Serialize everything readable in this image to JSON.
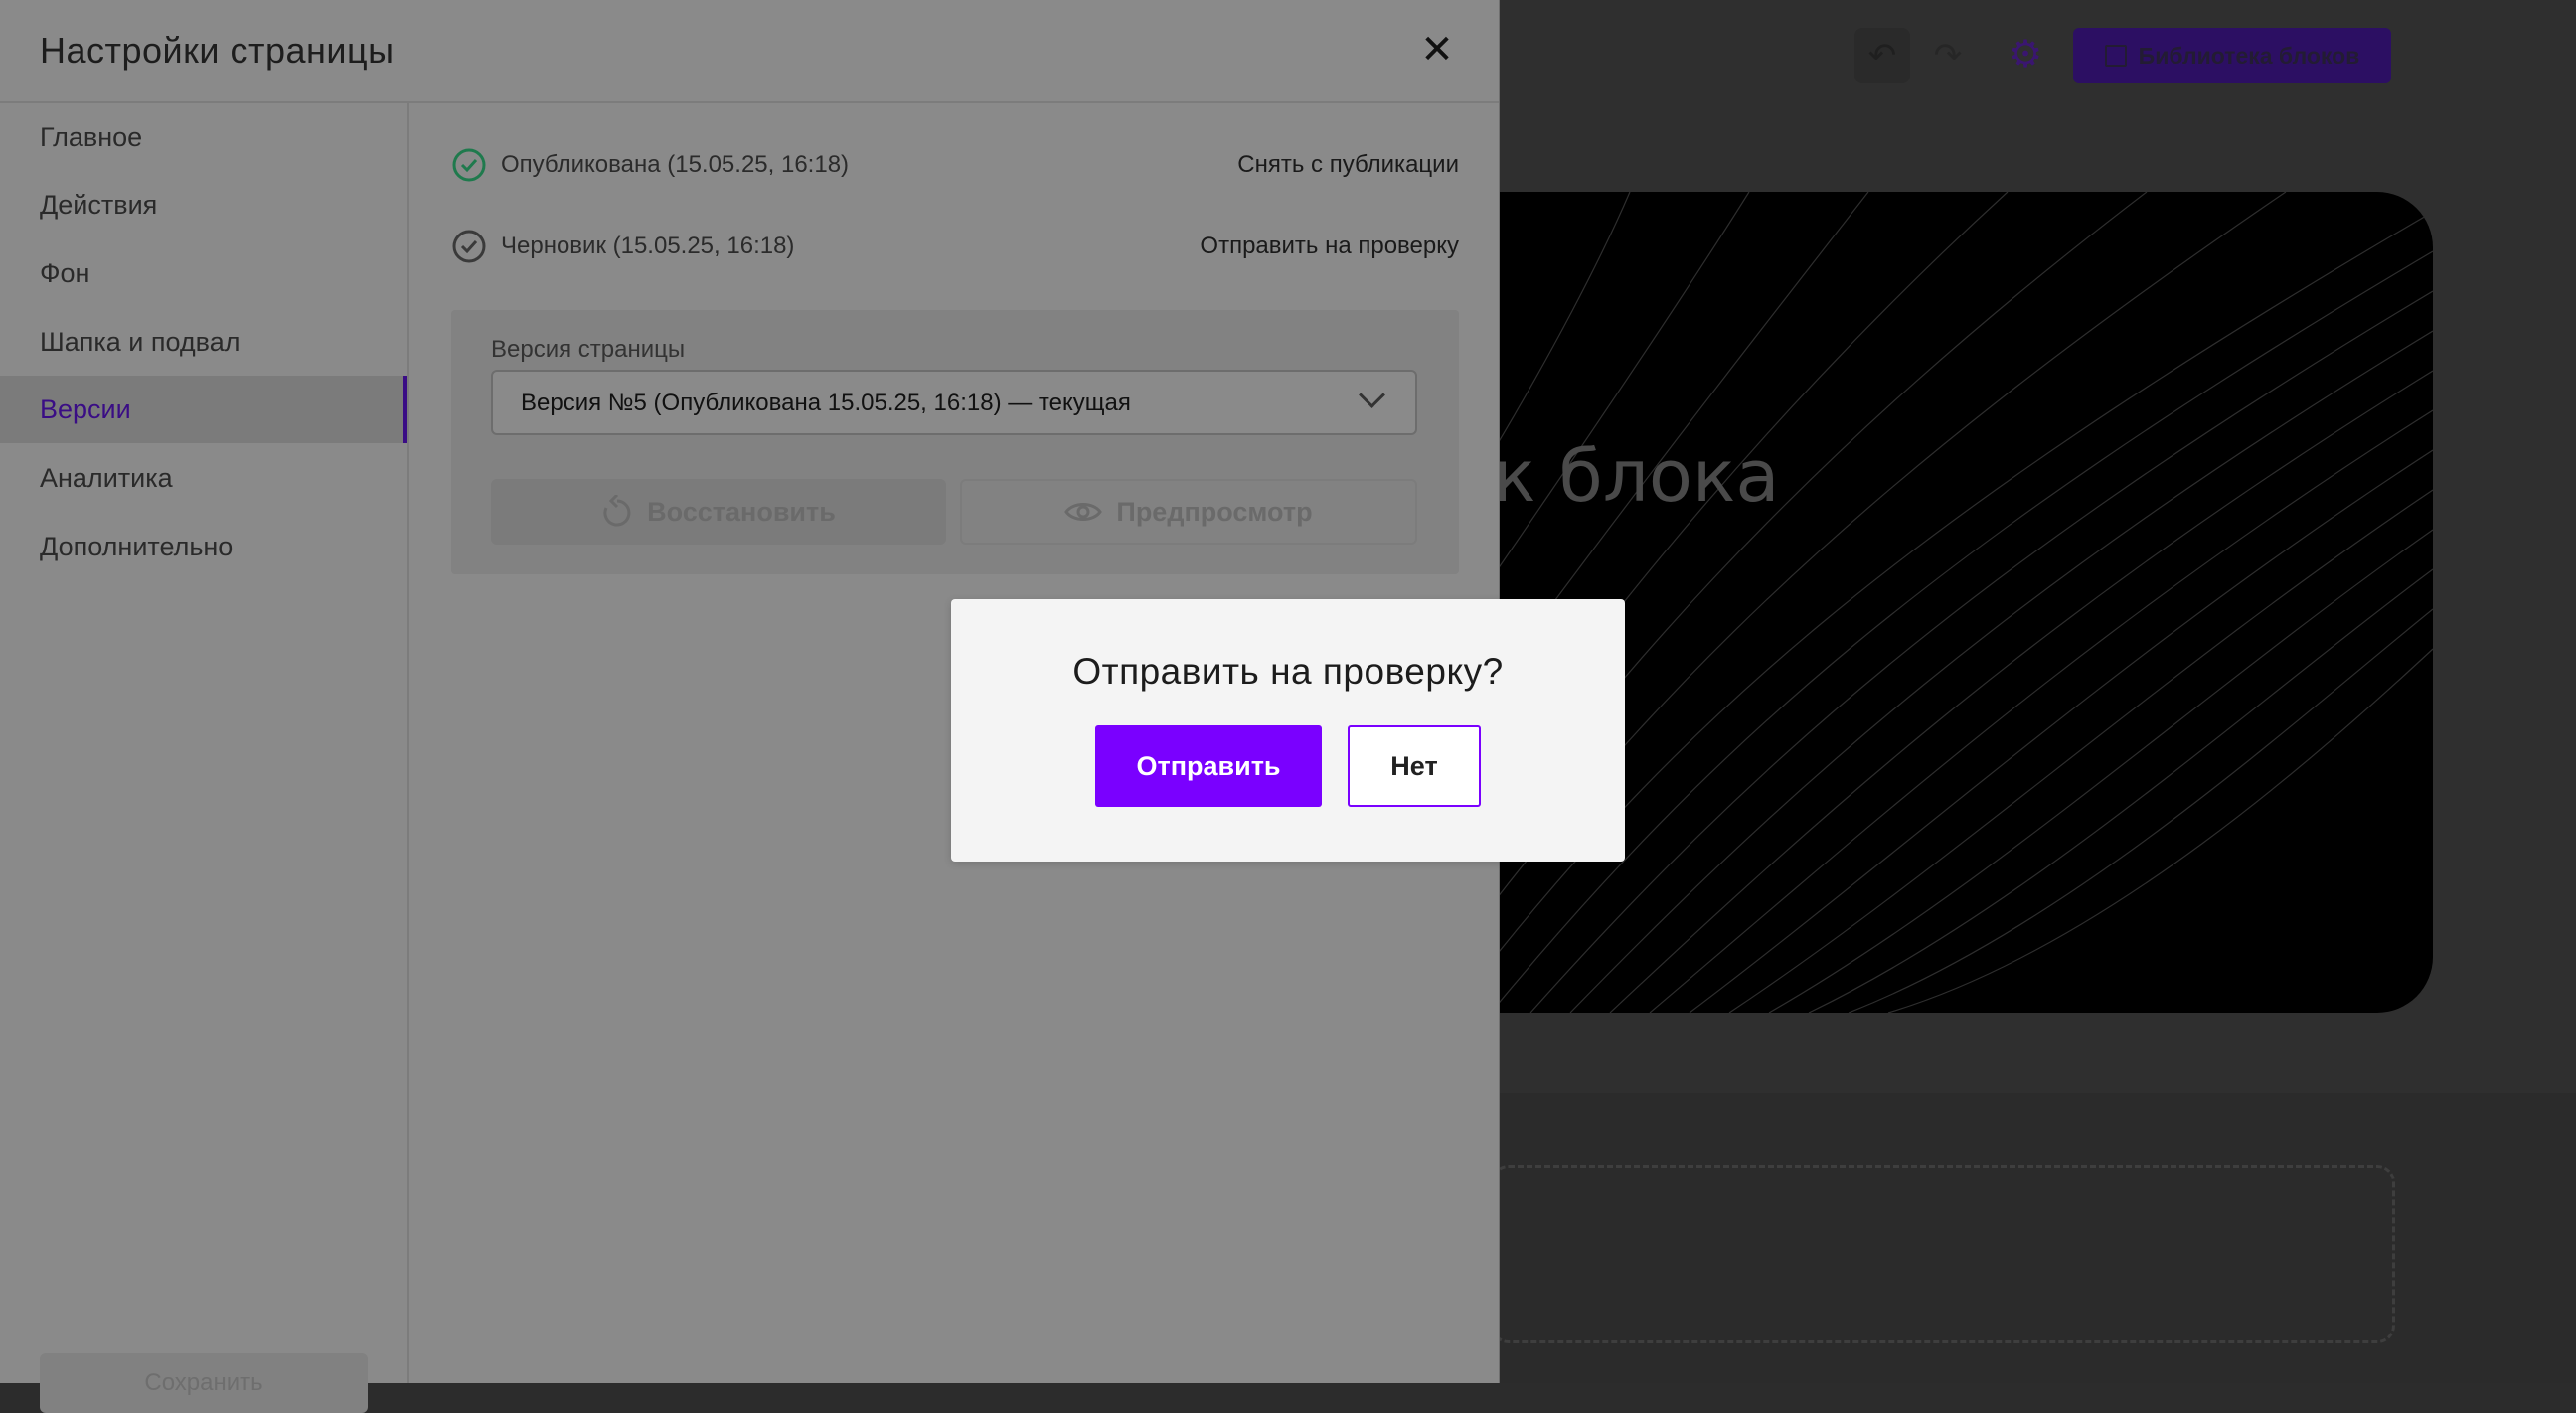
{
  "panel": {
    "title": "Настройки страницы",
    "close_icon": "close-icon"
  },
  "sidebar": {
    "items": [
      {
        "label": "Главное"
      },
      {
        "label": "Действия"
      },
      {
        "label": "Фон"
      },
      {
        "label": "Шапка и подвал"
      },
      {
        "label": "Версии",
        "active": true
      },
      {
        "label": "Аналитика"
      },
      {
        "label": "Дополнительно"
      }
    ],
    "save_label": "Сохранить"
  },
  "statuses": [
    {
      "text": "Опубликована (15.05.25, 16:18)",
      "action": "Снять с публикации",
      "icon": "check-circle-icon",
      "color": "#1f7a4d"
    },
    {
      "text": "Черновик (15.05.25, 16:18)",
      "action": "Отправить на проверку",
      "icon": "check-circle-icon",
      "color": "#3a3a3a"
    }
  ],
  "versions": {
    "label": "Версия страницы",
    "selected": "Версия №5 (Опубликована 15.05.25, 16:18) — текущая",
    "restore_label": "Восстановить",
    "preview_label": "Предпросмотр"
  },
  "editor": {
    "library_label": "Библиотека блоков",
    "hero_title": "ок блока"
  },
  "dialog": {
    "title": "Отправить на проверку?",
    "confirm_label": "Отправить",
    "cancel_label": "Нет",
    "accent": "#7a00ff"
  }
}
